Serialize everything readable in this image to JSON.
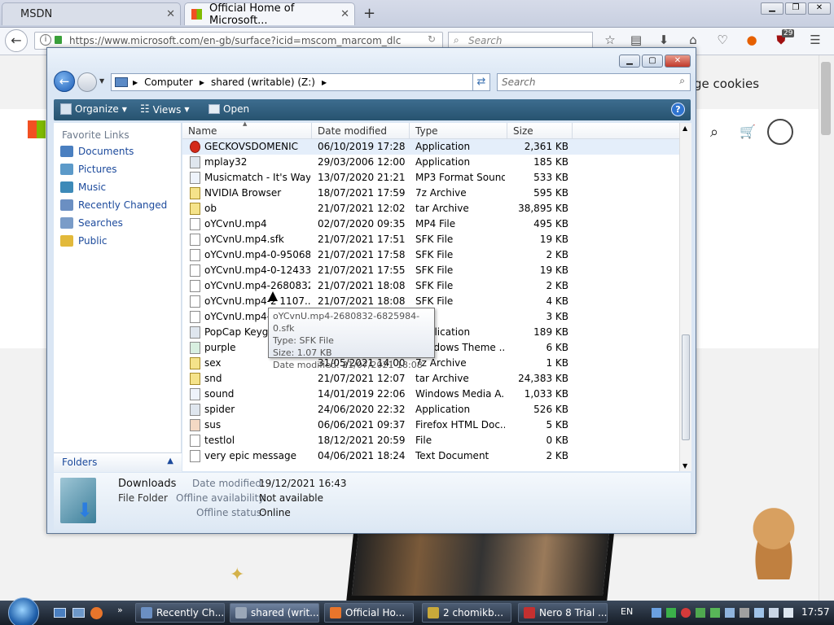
{
  "browser": {
    "tabs": [
      {
        "label": "MSDN"
      },
      {
        "label": "Official Home of Microsoft..."
      }
    ],
    "new_tab": "+",
    "url": "https://www.microsoft.com/en-gb/surface?icid=mscom_marcom_dlc",
    "search_placeholder": "Search",
    "badge": "29",
    "page_banner": "ge cookies"
  },
  "explorer": {
    "breadcrumb": [
      "Computer",
      "shared (writable) (Z:)"
    ],
    "search_placeholder": "Search",
    "commands": {
      "organize": "Organize",
      "views": "Views",
      "open": "Open"
    },
    "nav_header": "Favorite Links",
    "nav_items": [
      {
        "label": "Documents",
        "color": "#4a7fc0"
      },
      {
        "label": "Pictures",
        "color": "#5c9ac9"
      },
      {
        "label": "Music",
        "color": "#3d8ab8"
      },
      {
        "label": "Recently Changed",
        "color": "#6b8fc2"
      },
      {
        "label": "Searches",
        "color": "#7a9cc8"
      },
      {
        "label": "Public",
        "color": "#e2b93b"
      }
    ],
    "folders_label": "Folders",
    "columns": [
      "Name",
      "Date modified",
      "Type",
      "Size"
    ],
    "rows": [
      {
        "name": "GECKOVSDOMENIC",
        "date": "06/10/2019 17:28",
        "type": "Application",
        "size": "2,361 KB",
        "icon": "red-app",
        "selected": true
      },
      {
        "name": "mplay32",
        "date": "29/03/2006 12:00",
        "type": "Application",
        "size": "185 KB",
        "icon": "app"
      },
      {
        "name": "Musicmatch - It's Way ...",
        "date": "13/07/2020 21:21",
        "type": "MP3 Format Sound",
        "size": "533 KB",
        "icon": "music"
      },
      {
        "name": "NVIDIA Browser",
        "date": "18/07/2021 17:59",
        "type": "7z Archive",
        "size": "595 KB",
        "icon": "archive"
      },
      {
        "name": "ob",
        "date": "21/07/2021 12:02",
        "type": "tar Archive",
        "size": "38,895 KB",
        "icon": "archive"
      },
      {
        "name": "oYCvnU.mp4",
        "date": "02/07/2020 09:35",
        "type": "MP4 File",
        "size": "495 KB",
        "icon": "file"
      },
      {
        "name": "oYCvnU.mp4.sfk",
        "date": "21/07/2021 17:51",
        "type": "SFK File",
        "size": "19 KB",
        "icon": "file"
      },
      {
        "name": "oYCvnU.mp4-0-95068...",
        "date": "21/07/2021 17:58",
        "type": "SFK File",
        "size": "2 KB",
        "icon": "file"
      },
      {
        "name": "oYCvnU.mp4-0-12433...",
        "date": "21/07/2021 17:55",
        "type": "SFK File",
        "size": "19 KB",
        "icon": "file"
      },
      {
        "name": "oYCvnU.mp4-2680832...",
        "date": "21/07/2021 18:08",
        "type": "SFK File",
        "size": "2 KB",
        "icon": "file"
      },
      {
        "name": "oYCvnU.mp4-2  1107...",
        "date": "21/07/2021 18:08",
        "type": "SFK File",
        "size": "4 KB",
        "icon": "file"
      },
      {
        "name": "oYCvnU.mp4-2",
        "date": "",
        "type": "File",
        "size": "3 KB",
        "icon": "file"
      },
      {
        "name": "PopCap Keygen",
        "date": "",
        "type": "Application",
        "size": "189 KB",
        "icon": "app"
      },
      {
        "name": "purple",
        "date": "",
        "type": "Windows Theme ...",
        "size": "6 KB",
        "icon": "theme"
      },
      {
        "name": "sex",
        "date": "31/05/2021 14:00",
        "type": "7z Archive",
        "size": "1 KB",
        "icon": "archive"
      },
      {
        "name": "snd",
        "date": "21/07/2021 12:07",
        "type": "tar Archive",
        "size": "24,383 KB",
        "icon": "archive"
      },
      {
        "name": "sound",
        "date": "14/01/2019 22:06",
        "type": "Windows Media A...",
        "size": "1,033 KB",
        "icon": "music"
      },
      {
        "name": "spider",
        "date": "24/06/2020 22:32",
        "type": "Application",
        "size": "526 KB",
        "icon": "app"
      },
      {
        "name": "sus",
        "date": "06/06/2021 09:37",
        "type": "Firefox HTML Doc...",
        "size": "5 KB",
        "icon": "html"
      },
      {
        "name": "testlol",
        "date": "18/12/2021 20:59",
        "type": "File",
        "size": "0 KB",
        "icon": "file"
      },
      {
        "name": "very epic message",
        "date": "04/06/2021 18:24",
        "type": "Text Document",
        "size": "2 KB",
        "icon": "file"
      }
    ],
    "tooltip": {
      "name": "oYCvnU.mp4-2680832-6825984-0.sfk",
      "type": "Type: SFK File",
      "size": "Size: 1.07 KB",
      "date": "Date modified: 21/07/2021 18:08"
    },
    "details": {
      "name": "Downloads",
      "kind": "File Folder",
      "date_label": "Date modified:",
      "date_value": "19/12/2021 16:43",
      "offline_label": "Offline availability:",
      "offline_value": "Not available",
      "status_label": "Offline status:",
      "status_value": "Online"
    }
  },
  "taskbar": {
    "buttons": [
      {
        "label": "Recently Ch...",
        "color": "#6b8fc2"
      },
      {
        "label": "shared (writ...",
        "color": "#9aa7b8",
        "active": true
      },
      {
        "label": "Official Ho...",
        "color": "#e8752b"
      },
      {
        "label": "2 chomikb...",
        "color": "#c9a93a"
      },
      {
        "label": "Nero 8 Trial ...",
        "color": "#c43030"
      }
    ],
    "language": "EN",
    "clock": "17:57"
  }
}
